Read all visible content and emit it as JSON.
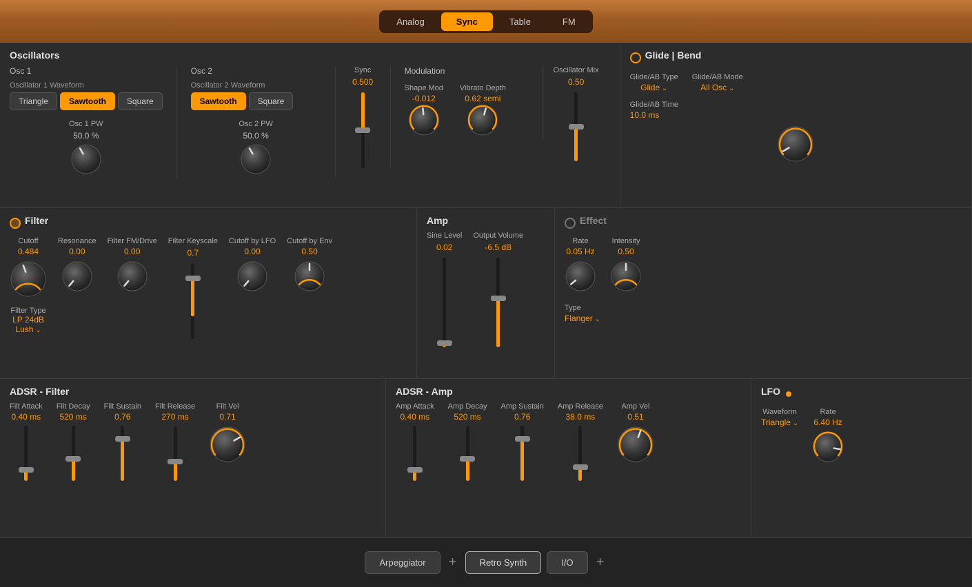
{
  "topBar": {
    "tabs": [
      {
        "id": "analog",
        "label": "Analog",
        "active": false
      },
      {
        "id": "sync",
        "label": "Sync",
        "active": true
      },
      {
        "id": "table",
        "label": "Table",
        "active": false
      },
      {
        "id": "fm",
        "label": "FM",
        "active": false
      }
    ]
  },
  "oscillators": {
    "title": "Oscillators",
    "osc1": {
      "label": "Osc 1",
      "waveformLabel": "Oscillator 1 Waveform",
      "buttons": [
        "Triangle",
        "Sawtooth",
        "Square"
      ],
      "activeButton": "Sawtooth",
      "pwLabel": "Osc 1 PW",
      "pwValue": "50.0 %"
    },
    "osc2": {
      "label": "Osc 2",
      "waveformLabel": "Oscillator 2 Waveform",
      "buttons": [
        "Sawtooth",
        "Square"
      ],
      "activeButton": "Sawtooth",
      "pwLabel": "Osc 2 PW",
      "pwValue": "50.0 %"
    },
    "sync": {
      "label": "Sync",
      "value": "0.500"
    },
    "modulation": {
      "label": "Modulation",
      "shapeMod": {
        "label": "Shape Mod",
        "value": "-0.012"
      },
      "vibratoDepth": {
        "label": "Vibrato Depth",
        "value": "0.62 semi"
      }
    },
    "oscMix": {
      "label": "Oscillator Mix",
      "value": "0.50"
    }
  },
  "glide": {
    "title": "Glide | Bend",
    "glideTypeLabel": "Glide/AB Type",
    "glideTypeValue": "Glide",
    "glideModeLabel": "Glide/AB Mode",
    "glideModeValue": "All Osc",
    "glideTimeLabel": "Glide/AB Time",
    "glideTimeValue": "10.0 ms"
  },
  "filter": {
    "title": "Filter",
    "enabled": true,
    "cutoff": {
      "label": "Cutoff",
      "value": "0.484"
    },
    "resonance": {
      "label": "Resonance",
      "value": "0.00"
    },
    "fmDrive": {
      "label": "Filter FM/Drive",
      "value": "0.00"
    },
    "keyScale": {
      "label": "Filter Keyscale",
      "value": "0.7"
    },
    "cutoffLFO": {
      "label": "Cutoff by LFO",
      "value": "0.00"
    },
    "cutoffEnv": {
      "label": "Cutoff by Env",
      "value": "0.50"
    },
    "filterType": {
      "label": "Filter Type",
      "value": "LP 24dB\nLush"
    }
  },
  "amp": {
    "title": "Amp",
    "sineLevel": {
      "label": "Sine Level",
      "value": "0.02"
    },
    "outputVolume": {
      "label": "Output Volume",
      "value": "-6.5 dB"
    }
  },
  "effect": {
    "title": "Effect",
    "enabled": false,
    "rate": {
      "label": "Rate",
      "value": "0.05 Hz"
    },
    "intensity": {
      "label": "Intensity",
      "value": "0.50"
    },
    "type": {
      "label": "Type",
      "value": "Flanger"
    }
  },
  "adsrFilter": {
    "title": "ADSR - Filter",
    "attack": {
      "label": "Filt Attack",
      "value": "0.40 ms"
    },
    "decay": {
      "label": "Filt Decay",
      "value": "520 ms"
    },
    "sustain": {
      "label": "Filt Sustain",
      "value": "0.76"
    },
    "release": {
      "label": "Filt Release",
      "value": "270 ms"
    },
    "vel": {
      "label": "Filt Vel",
      "value": "0.71"
    }
  },
  "adsrAmp": {
    "title": "ADSR - Amp",
    "attack": {
      "label": "Amp Attack",
      "value": "0.40 ms"
    },
    "decay": {
      "label": "Amp Decay",
      "value": "520 ms"
    },
    "sustain": {
      "label": "Amp Sustain",
      "value": "0.76"
    },
    "release": {
      "label": "Amp Release",
      "value": "38.0 ms"
    },
    "vel": {
      "label": "Amp Vel",
      "value": "0.51"
    }
  },
  "lfo": {
    "title": "LFO",
    "waveform": {
      "label": "Waveform",
      "value": "Triangle"
    },
    "rate": {
      "label": "Rate",
      "value": "6.40 Hz"
    }
  },
  "bottomBar": {
    "arpeggiatorLabel": "Arpeggiator",
    "retroSynthLabel": "Retro Synth",
    "ioLabel": "I/O"
  }
}
